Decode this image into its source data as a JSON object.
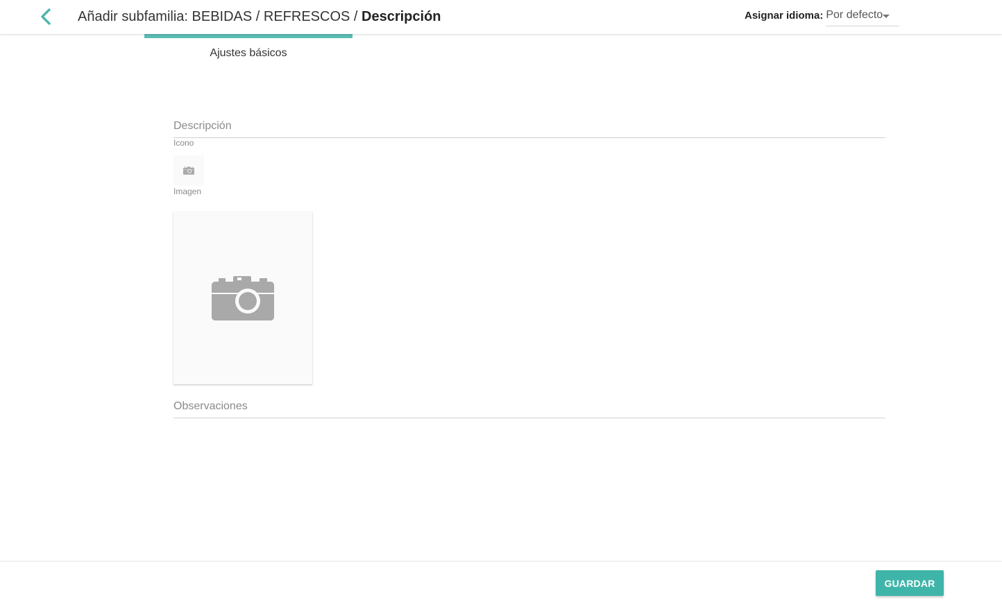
{
  "header": {
    "title_prefix": "Añadir subfamilia: BEBIDAS / REFRESCOS / ",
    "title_current": "Descripción",
    "language_label": "Asignar idioma:",
    "language_value": "Por defecto",
    "back_icon": "chevron-left-icon"
  },
  "tabs": [
    {
      "label": "Ajustes básicos",
      "active": true
    }
  ],
  "form": {
    "description_placeholder": "Descripción",
    "icon_label": "Icono",
    "icon_placeholder_icon": "camera-icon",
    "image_label": "Imagen",
    "image_placeholder_icon": "camera-icon",
    "observations_placeholder": "Observaciones"
  },
  "footer": {
    "save_label": "GUARDAR"
  },
  "colors": {
    "accent": "#5bbcb3",
    "button": "#3fb5a9",
    "placeholder_icon": "#a9a9a9"
  }
}
